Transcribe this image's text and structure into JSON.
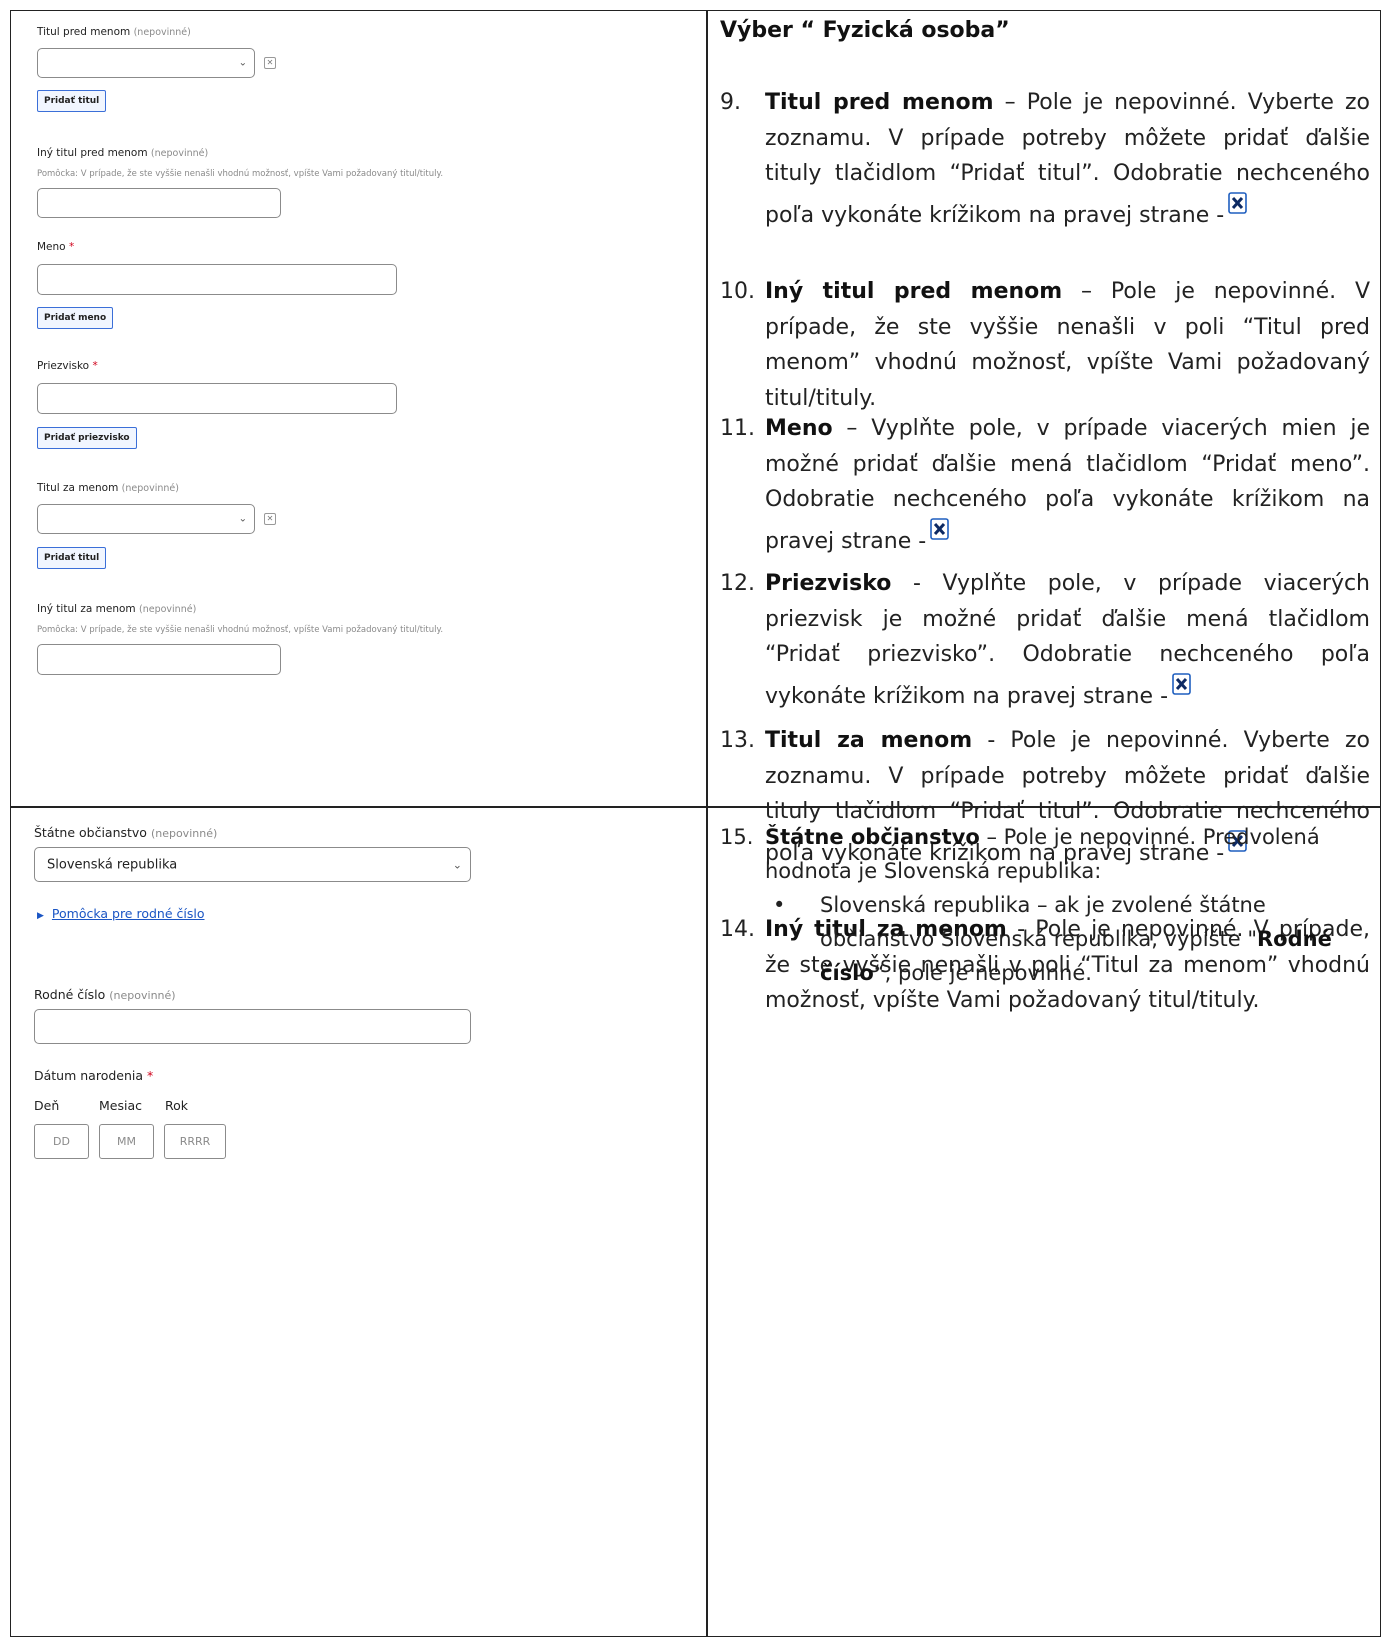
{
  "form_top": {
    "titul_pred": {
      "label": "Titul pred menom",
      "opt": "(nepovinné)",
      "button": "Pridať titul"
    },
    "iny_titul_pred": {
      "label": "Iný titul pred menom",
      "opt": "(nepovinné)",
      "hint": "Pomôcka: V prípade, že ste vyššie nenašli vhodnú možnosť, vpíšte Vami požadovaný titul/tituly."
    },
    "meno": {
      "label": "Meno",
      "req": "*",
      "button": "Pridať meno"
    },
    "priezvisko": {
      "label": "Priezvisko",
      "req": "*",
      "button": "Pridať priezvisko"
    },
    "titul_za": {
      "label": "Titul za menom",
      "opt": "(nepovinné)",
      "button": "Pridať titul"
    },
    "iny_titul_za": {
      "label": "Iný titul za menom",
      "opt": "(nepovinné)",
      "hint": "Pomôcka: V prípade, že ste vyššie nenašli vhodnú možnosť, vpíšte Vami požadovaný titul/tituly."
    },
    "x_glyph": "✕"
  },
  "form_bottom": {
    "statne": {
      "label": "Štátne občianstvo",
      "opt": "(nepovinné)",
      "value": "Slovenská republika"
    },
    "pomocka_link": "Pomôcka pre rodné číslo",
    "rodne": {
      "label": "Rodné číslo",
      "opt": "(nepovinné)"
    },
    "datum": {
      "label": "Dátum narodenia",
      "req": "*",
      "den": "Deň",
      "mesiac": "Mesiac",
      "rok": "Rok",
      "ph_dd": "DD",
      "ph_mm": "MM",
      "ph_rrrr": "RRRR"
    }
  },
  "right": {
    "title": "Výber “ Fyzická osoba”",
    "items": [
      {
        "num": "9.",
        "bold": "Titul pred menom",
        "text": " – Pole je nepovinné. Vyberte zo zoznamu. V prípade potreby môžete pridať ďalšie tituly tlačidlom “Pridať titul”. Odobratie nechceného poľa vykonáte krížikom na pravej strane -"
      },
      {
        "num": "10.",
        "bold": "Iný titul pred menom",
        "text": " – Pole je nepovinné. V prípade, že ste vyššie nenašli v poli “Titul pred menom” vhodnú možnosť, vpíšte Vami požadovaný titul/tituly."
      },
      {
        "num": "11.",
        "bold": "Meno",
        "text": " – Vyplňte pole, v prípade viacerých mien je možné pridať ďalšie mená tlačidlom “Pridať meno”. Odobratie nechceného poľa vykonáte krížikom na pravej strane -"
      },
      {
        "num": "12.",
        "bold": "Priezvisko",
        "text": " - Vyplňte pole, v prípade viacerých priezvisk je možné pridať ďalšie mená tlačidlom “Pridať priezvisko”. Odobratie nechceného poľa vykonáte krížikom na pravej strane -"
      },
      {
        "num": "13.",
        "bold": "Titul za menom",
        "text": " - Pole je nepovinné. Vyberte zo zoznamu. V prípade potreby môžete pridať ďalšie tituly tlačidlom “Pridať titul”. Odobratie nechceného poľa vykonáte krížikom na pravej strane -"
      },
      {
        "num": "14.",
        "bold": "Iný titul za menom",
        "text": " - Pole je nepovinné. V prípade, že ste vyššie nenašli v poli “Titul za menom” vhodnú možnosť, vpíšte Vami požadovaný titul/tituly."
      },
      {
        "num": "15.",
        "bold": "Štátne občianstvo",
        "text": " – Pole je nepovinné. Predvolená hodnota je Slovenská republika:"
      }
    ],
    "bullet": {
      "glyph": "•",
      "pre": "Slovenská republika – ak je zvolené štátne občianstvo Slovenská republika, vypíšte \"",
      "bold": "Rodné číslo",
      "post": "“, pole je nepovinné."
    }
  },
  "colors": {
    "link": "#1a55c4",
    "button_border": "#3b6fd8",
    "icon_blue": "#1f5fbf",
    "required": "#d0021b"
  }
}
